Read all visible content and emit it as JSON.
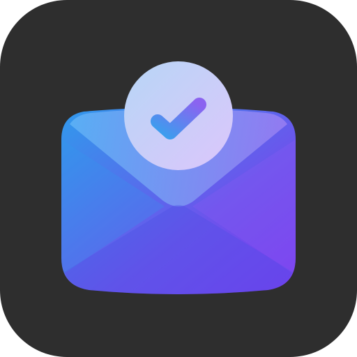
{
  "icon": {
    "name": "mail-verified-app-icon",
    "tile_color": "#2e2e2e",
    "envelope_gradient": [
      "#2f9bec",
      "#6b55ec",
      "#7a3cf0"
    ],
    "flap_gradient": [
      "#5fb3f5",
      "#9a7ff2"
    ],
    "badge_gradient": [
      "#b7d6f6",
      "#dcc6fb"
    ],
    "check_gradient": [
      "#3a9fee",
      "#8b63f0"
    ],
    "symbols": [
      "envelope-icon",
      "check-badge-icon",
      "checkmark-icon"
    ]
  }
}
